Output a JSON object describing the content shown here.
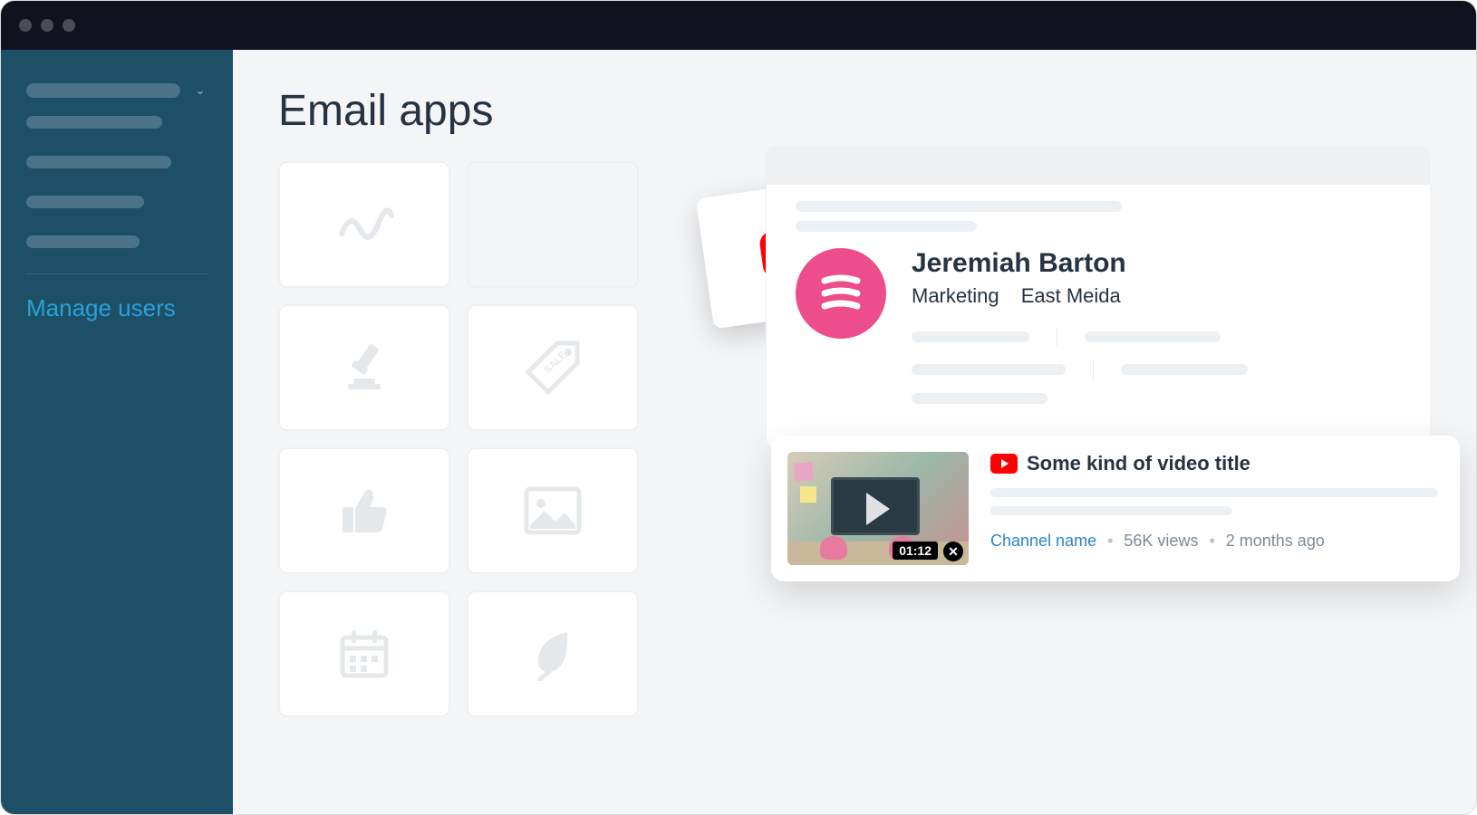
{
  "page": {
    "title": "Email apps"
  },
  "sidebar": {
    "manage_users": "Manage users"
  },
  "app_tiles": [
    {
      "icon": "scribble"
    },
    {
      "icon": "youtube-slot"
    },
    {
      "icon": "gavel"
    },
    {
      "icon": "sale-tag"
    },
    {
      "icon": "thumbs-up"
    },
    {
      "icon": "image"
    },
    {
      "icon": "calendar"
    },
    {
      "icon": "leaf"
    }
  ],
  "profile": {
    "name": "Jeremiah Barton",
    "subtitle1": "Marketing",
    "subtitle2": "East Meida"
  },
  "video": {
    "title": "Some kind of video title",
    "duration": "01:12",
    "channel": "Channel name",
    "views": "56K views",
    "age": "2 months ago",
    "close": "✕"
  }
}
